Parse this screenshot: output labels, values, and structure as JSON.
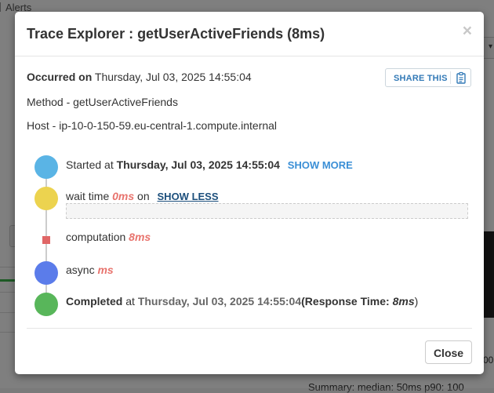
{
  "background": {
    "tab_label": "Alerts",
    "select_caret": "▾",
    "right_text": "00",
    "summary_text": "Summary:  median: 50ms    p90: 100"
  },
  "modal": {
    "title": "Trace Explorer : getUserActiveFriends (8ms)",
    "close_symbol": "×",
    "occurred_label": "Occurred on",
    "occurred_value": "Thursday, Jul 03, 2025 14:55:04",
    "share_label": "SHARE THIS",
    "share_icon": "clipboard-icon",
    "method_line": "Method - getUserActiveFriends",
    "host_line": "Host - ip-10-0-150-59.eu-central-1.compute.internal",
    "timeline": {
      "started_prefix": "Started at",
      "started_time": "Thursday, Jul 03, 2025 14:55:04",
      "show_more": "SHOW MORE",
      "wait_prefix": "wait time",
      "wait_value": "0ms",
      "wait_suffix": "on",
      "show_less": "SHOW LESS",
      "computation_label": "computation",
      "computation_value": "8ms",
      "async_label": "async",
      "async_value": "ms",
      "completed_label": "Completed",
      "completed_at": "at",
      "completed_time": "Thursday, Jul 03, 2025 14:55:04",
      "response_open": "(",
      "response_label": "Response Time:",
      "response_value": "8ms",
      "response_close": ")"
    },
    "close_button": "Close"
  },
  "colors": {
    "started_dot": "#5ab4e5",
    "wait_dot": "#ecd34f",
    "computation_marker": "#e06666",
    "async_dot": "#5b7cea",
    "completed_dot": "#58b65a",
    "accent_value": "#e8736d",
    "link": "#3b8fd6"
  }
}
